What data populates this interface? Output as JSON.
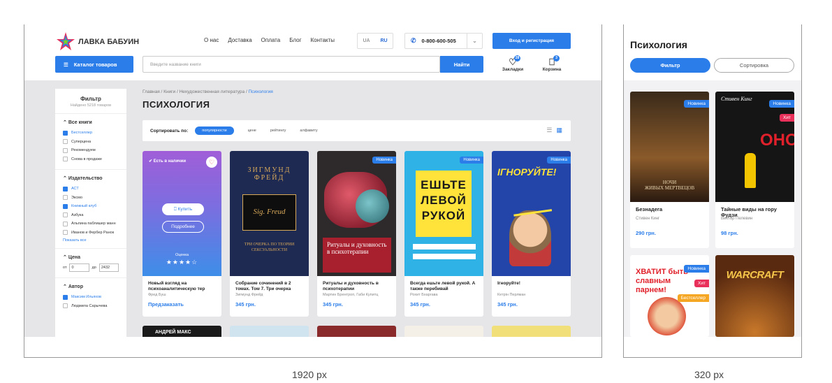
{
  "desktop": {
    "logo_text": "ЛАВКА БАБУИН",
    "nav": [
      "О нас",
      "Доставка",
      "Оплата",
      "Блог",
      "Контакты"
    ],
    "lang": {
      "ua": "UA",
      "ru": "RU"
    },
    "phone": "0-800-600-505",
    "login": "Вход и регистрация",
    "catalog": "Каталог товаров",
    "search_placeholder": "Введите название книги",
    "search_button": "Найти",
    "bookmarks": {
      "label": "Закладки",
      "count": "28"
    },
    "cart": {
      "label": "Корзина",
      "count": "3"
    },
    "filter": {
      "title": "Фильтр",
      "found": "Найдено 5218 товаров",
      "all_books": {
        "title": "Все книги",
        "items": [
          {
            "label": "Бестселлер",
            "checked": true
          },
          {
            "label": "Суперцена",
            "checked": false
          },
          {
            "label": "Рекомендуем",
            "checked": false
          },
          {
            "label": "Снова в продаже",
            "checked": false
          }
        ]
      },
      "publisher": {
        "title": "Издательство",
        "items": [
          {
            "label": "АСТ",
            "checked": true
          },
          {
            "label": "Эксмо",
            "checked": false
          },
          {
            "label": "Книжный клуб",
            "checked": true
          },
          {
            "label": "Азбука",
            "checked": false
          },
          {
            "label": "Альпина паблишер манн",
            "checked": false
          },
          {
            "label": "Иванов и Фербер Ранок",
            "checked": false
          }
        ],
        "show_all": "Показать все"
      },
      "price": {
        "title": "Цена",
        "from_label": "от",
        "from": "0",
        "to_label": "до",
        "to": "2432"
      },
      "author": {
        "title": "Автор",
        "items": [
          {
            "label": "Максим Ильяхов",
            "checked": true
          },
          {
            "label": "Людмила Сарычева",
            "checked": false
          }
        ]
      }
    },
    "breadcrumb": {
      "path": "Главная / Книги / Нехудожественная литература / ",
      "current": "Психология"
    },
    "page_title": "ПСИХОЛОГИЯ",
    "sort": {
      "label": "Сортировать по:",
      "active": "популярности",
      "options": [
        "цене",
        "рейтингу",
        "алфавиту"
      ]
    },
    "products": [
      {
        "title": "Новый взгляд на психоаналитическую тер",
        "author": "Фред Буш",
        "price": "Предзаказать",
        "in_stock": "Есть в наличии",
        "buy": "Купить",
        "details": "Подробнее",
        "rating_label": "Оценка",
        "stars": "★★★★☆"
      },
      {
        "title": "Собрание сочинений в 2 томах. Том 7. Три очерка",
        "author": "Зигмунд Фрейд",
        "price": "345 грн.",
        "cover_author": "ЗИГМУНД ФРЕЙД",
        "cover_title": "ТРИ ОЧЕРКА ПО ТЕОРИИ СЕКСУАЛЬНОСТИ"
      },
      {
        "title": "Ритуалы и духовность в психотерапии",
        "author": "Мартин Брентроп, Габи Купитц",
        "price": "345 грн.",
        "badge": "Новинка",
        "cover_title": "Ритуалы и духовность в психотерапии"
      },
      {
        "title": "Всегда ешьте левой рукой. А также перебивай",
        "author": "Рохит Бхаргава",
        "price": "345 грн.",
        "badge": "Новинка",
        "cover_title": "ЕШЬТЕ ЛЕВОЙ РУКОЙ"
      },
      {
        "title": "Ігноруйте!",
        "author": "Кетрін Перлман",
        "price": "345 грн.",
        "badge": "Новинка",
        "cover_title": "ІГНОРУЙТЕ!"
      }
    ],
    "row2_cover": "АНДРЕЙ МАКС"
  },
  "mobile": {
    "title": "Психология",
    "filter": "Фильтр",
    "sort": "Сортировка",
    "products": [
      {
        "title": "Безнадега",
        "author": "Стивен Кинг",
        "price": "290 грн.",
        "badges": [
          "Новинка"
        ]
      },
      {
        "title": "Тайные виды на гору Фудзи",
        "author": "Виктор Пелевин",
        "price": "98 грн.",
        "badges": [
          "Новинка",
          "Хит"
        ]
      }
    ],
    "row2": [
      {
        "badges": [
          "Новинка",
          "Хит",
          "Бестселлер"
        ],
        "cover_text": "ХВАТИТ быть славным парнем!"
      },
      {
        "badges": [],
        "cover_text": "WARCRAFT"
      }
    ]
  },
  "labels": {
    "desktop_width": "1920 px",
    "mobile_width": "320 px"
  },
  "colors": {
    "accent": "#2b7de9",
    "hit": "#e8305a",
    "bestseller": "#f5a623"
  }
}
